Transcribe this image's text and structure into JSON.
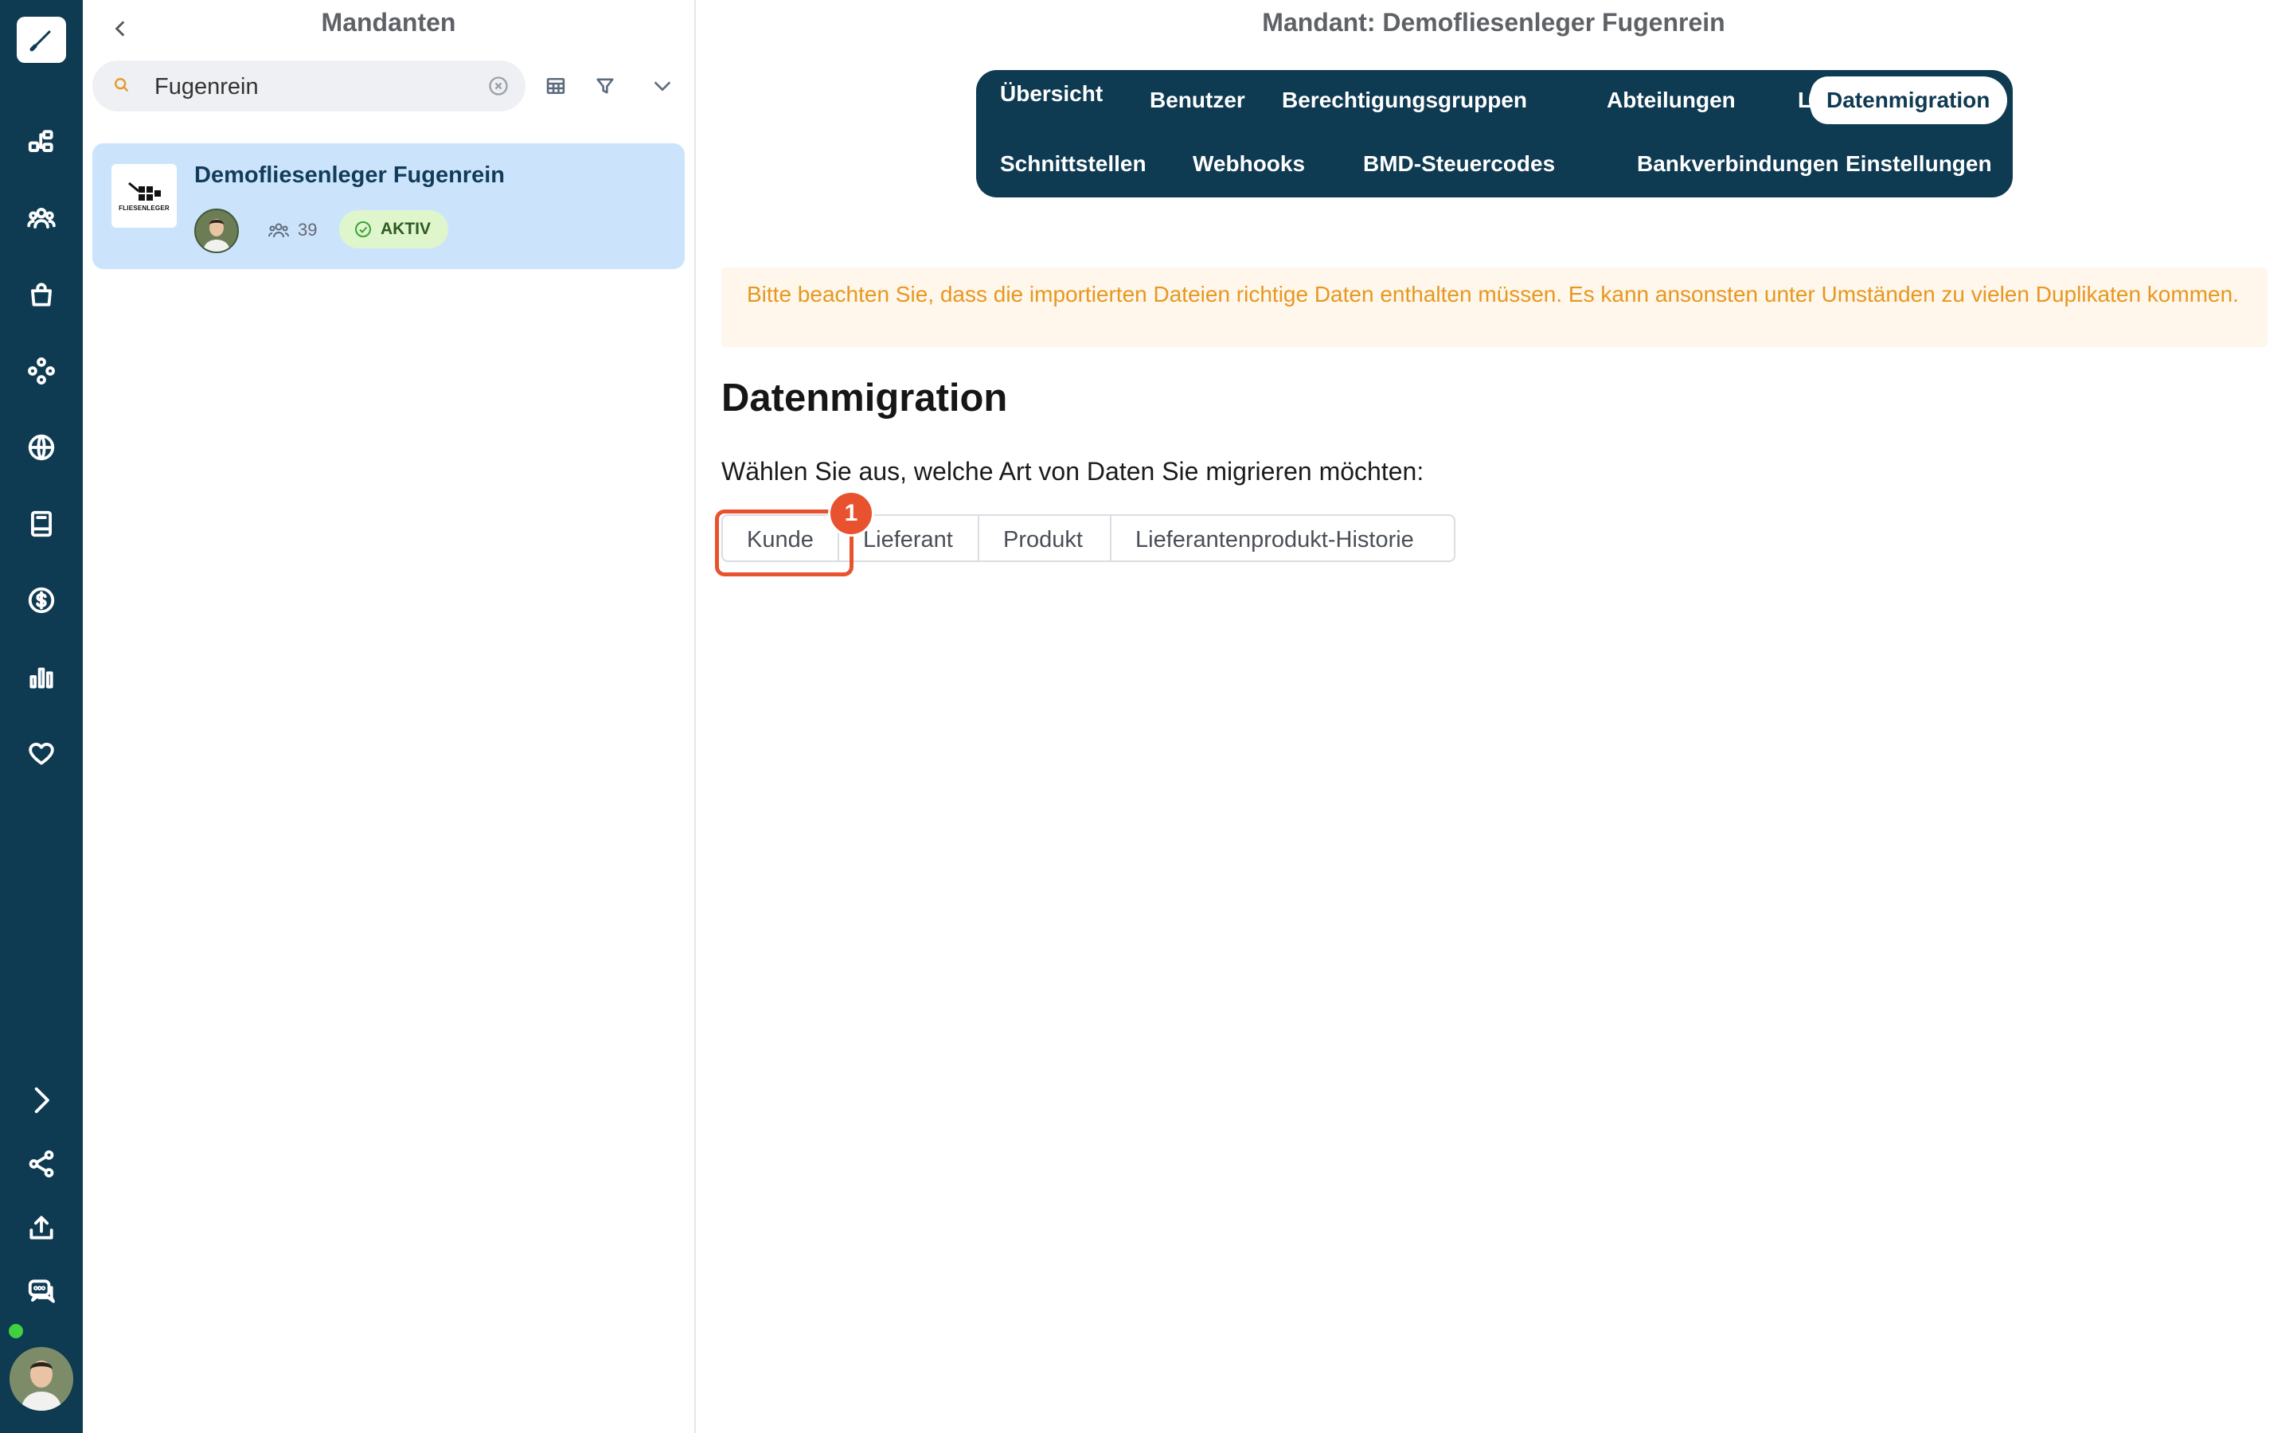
{
  "sidebar": {
    "logo_icon": "pen-logo-icon",
    "items": [
      {
        "icon": "org-chart-icon"
      },
      {
        "icon": "users-icon"
      },
      {
        "icon": "shopping-bag-icon"
      },
      {
        "icon": "modules-icon"
      },
      {
        "icon": "globe-icon"
      },
      {
        "icon": "book-icon"
      },
      {
        "icon": "dollar-icon"
      },
      {
        "icon": "bar-chart-icon"
      },
      {
        "icon": "heart-icon"
      }
    ],
    "bottom_items": [
      {
        "icon": "expand-chevron-icon"
      },
      {
        "icon": "share-icon"
      },
      {
        "icon": "upload-icon"
      },
      {
        "icon": "chat-icon"
      }
    ],
    "status_color": "#3fd13f"
  },
  "list_panel": {
    "title": "Mandanten",
    "search": {
      "value": "Fugenrein"
    },
    "items": [
      {
        "name": "Demofliesenleger Fugenrein",
        "logo_text": "FLIESENLEGER",
        "user_count": "39",
        "status": "AKTIV"
      }
    ]
  },
  "main": {
    "title": "Mandant: Demofliesenleger Fugenrein",
    "tabs_row1": [
      "Übersicht",
      "Benutzer",
      "Berechtigungsgruppen",
      "Abteilungen",
      "Lizenzen",
      "Datenmigration"
    ],
    "tabs_row2": [
      "Schnittstellen",
      "Webhooks",
      "BMD-Steuercodes",
      "Bankverbindungen",
      "Einstellungen"
    ],
    "active_tab": "Datenmigration",
    "warning": "Bitte beachten Sie, dass die importierten Dateien richtige Daten enthalten müssen. Es kann ansonsten unter Umständen zu vielen Duplikaten kommen.",
    "heading": "Datenmigration",
    "prompt": "Wählen Sie aus, welche Art von Daten Sie migrieren möchten:",
    "options": [
      "Kunde",
      "Lieferant",
      "Produkt",
      "Lieferantenprodukt-Historie"
    ],
    "step_marker": "1"
  },
  "colors": {
    "rail": "#0e3a52",
    "accent": "#e8522e",
    "warning_text": "#e6981f",
    "selected_card": "#cce4fb"
  }
}
